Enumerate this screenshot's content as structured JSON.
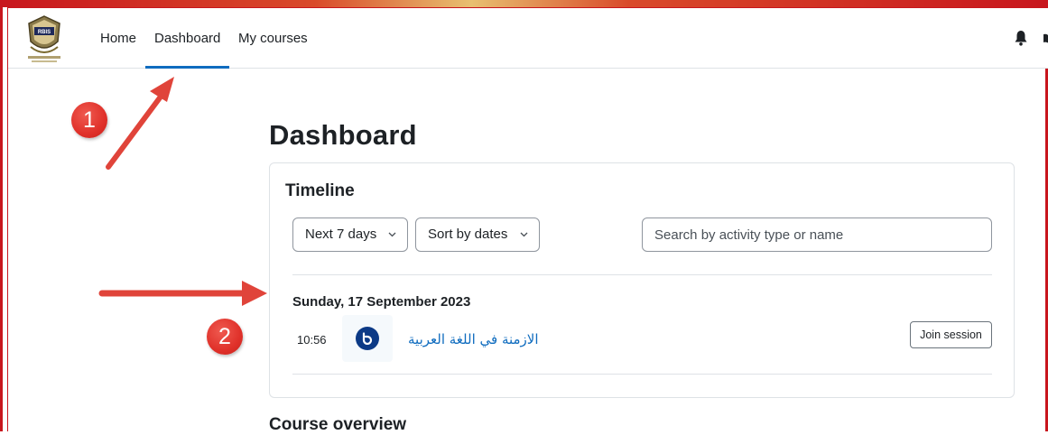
{
  "nav": {
    "home": "Home",
    "dashboard": "Dashboard",
    "my_courses": "My courses",
    "logo_text": "RBIS"
  },
  "page": {
    "title": "Dashboard"
  },
  "timeline": {
    "title": "Timeline",
    "filter_label": "Next 7 days",
    "sort_label": "Sort by dates",
    "search_placeholder": "Search by activity type or name",
    "date_heading": "Sunday, 17 September 2023",
    "events": [
      {
        "time": "10:56",
        "icon": "bigbluebutton-icon",
        "name": "الازمنة في اللغة العربية",
        "action": "Join session"
      }
    ]
  },
  "next_section": {
    "title": "Course overview"
  },
  "annotations": {
    "badge_1": "1",
    "badge_2": "2"
  },
  "colors": {
    "accent": "#0f6cbf",
    "annotation_red": "#e0312a",
    "frame_red": "#c8161d",
    "event_icon": "#0c3a86"
  }
}
